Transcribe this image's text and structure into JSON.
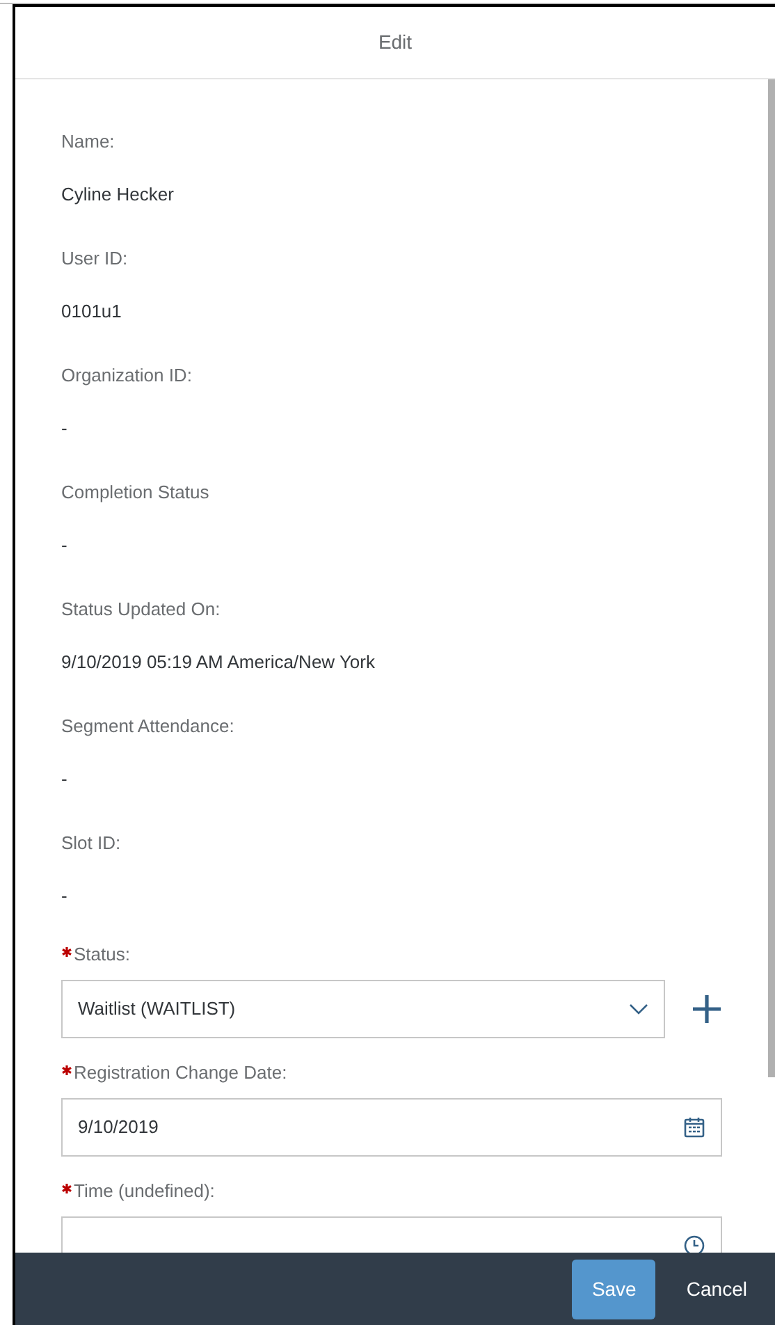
{
  "dialog": {
    "title": "Edit"
  },
  "details": [
    {
      "label": "Name:",
      "value": "Cyline Hecker"
    },
    {
      "label": "User ID:",
      "value": "0101u1"
    },
    {
      "label": "Organization ID:",
      "value": "-"
    },
    {
      "label": "Completion Status",
      "value": "-"
    },
    {
      "label": "Status Updated On:",
      "value": "9/10/2019 05:19 AM America/New York"
    },
    {
      "label": "Segment Attendance:",
      "value": "-"
    },
    {
      "label": "Slot ID:",
      "value": "-"
    }
  ],
  "form": [
    {
      "kind": "select",
      "label": "Status:",
      "required": true,
      "value": "Waitlist (WAITLIST)"
    },
    {
      "kind": "date",
      "label": "Registration Change Date:",
      "required": true,
      "value": "9/10/2019"
    },
    {
      "kind": "time",
      "label": "Time (undefined):",
      "required": true
    }
  ],
  "footer": {
    "buttons": [
      {
        "label": "Save",
        "kind": "primary"
      },
      {
        "label": "Cancel",
        "kind": "plain"
      }
    ]
  }
}
